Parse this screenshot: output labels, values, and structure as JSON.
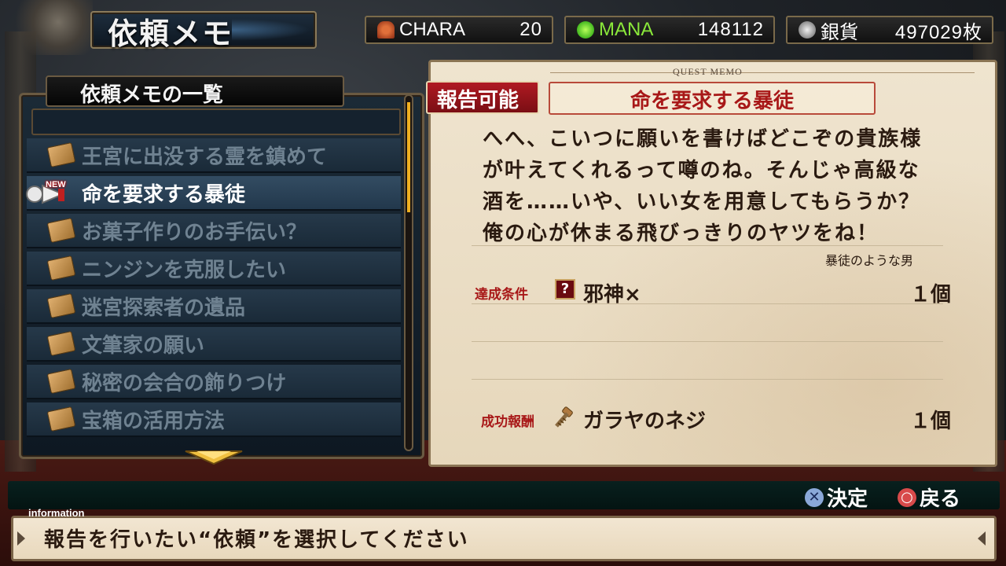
{
  "screen": {
    "title": "依頼メモ"
  },
  "stats": {
    "chara": {
      "label": "CHARA",
      "value": "20",
      "icon": "chara-icon"
    },
    "mana": {
      "label": "MANA",
      "value": "148112",
      "icon": "mana-orb-icon"
    },
    "silver": {
      "label": "銀貨",
      "value": "497029枚",
      "icon": "silver-coin-icon"
    }
  },
  "quest_list": {
    "header": "依頼メモの一覧",
    "new_badge": "NEW",
    "items": [
      {
        "label": "王宮に出没する霊を鎮めて",
        "selected": false
      },
      {
        "label": "命を要求する暴徒",
        "selected": true
      },
      {
        "label": "お菓子作りのお手伝い？",
        "selected": false
      },
      {
        "label": "ニンジンを克服したい",
        "selected": false
      },
      {
        "label": "迷宮探索者の遺品",
        "selected": false
      },
      {
        "label": "文筆家の願い",
        "selected": false
      },
      {
        "label": "秘密の会合の飾りつけ",
        "selected": false
      },
      {
        "label": "宝箱の活用方法",
        "selected": false
      }
    ]
  },
  "memo": {
    "heading": "QUEST MEMO",
    "status": "報告可能",
    "quest_name": "命を要求する暴徒",
    "body_lines": [
      "へへ、こいつに願いを書けばどこぞの貴族様",
      "が叶えてくれるって噂のね。そんじゃ高級な",
      "酒を……いや、いい女を用意してもらうか？",
      "俺の心が休まる飛びっきりのヤツをね！"
    ],
    "client": "暴徒のような男",
    "condition_label": "達成条件",
    "condition_icon": "?",
    "condition_item": "邪神×",
    "condition_count": "１個",
    "reward_label": "成功報酬",
    "reward_item": "ガラヤのネジ",
    "reward_count": "１個"
  },
  "controls": {
    "confirm_label": "決定",
    "back_label": "戻る"
  },
  "info": {
    "tab": "information",
    "message": "報告を行いたい“依頼”を選択してください"
  },
  "colors": {
    "accent_red": "#a81818",
    "mana_green": "#8ae83a",
    "scroll_gold": "#f0b020"
  }
}
